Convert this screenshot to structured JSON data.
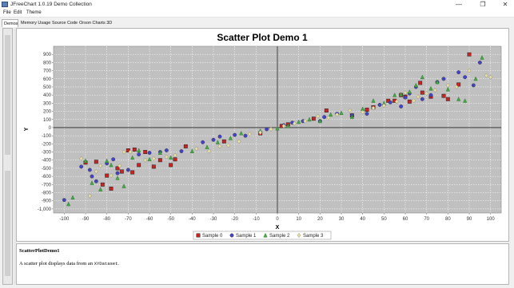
{
  "window": {
    "title": "JFreeChart 1.0.19 Demo Collection",
    "icon": "app-icon",
    "controls": [
      "—",
      "❐",
      "✕"
    ]
  },
  "menu": [
    "File",
    "Edit",
    "Theme"
  ],
  "tabs": [
    {
      "label": "Demos",
      "active": true
    },
    {
      "label": "Memory Usage",
      "active": false
    },
    {
      "label": "Source Code",
      "active": false
    },
    {
      "label": "Orson Charts 3D",
      "active": false
    }
  ],
  "description": {
    "title": "ScatterPlotDemo1",
    "text_prefix": "A scatter plot displays data from an ",
    "text_code": "XYDataset",
    "text_suffix": "."
  },
  "chart_data": {
    "type": "scatter",
    "title": "Scatter Plot Demo 1",
    "xlabel": "X",
    "ylabel": "Y",
    "xlim": [
      -105,
      105
    ],
    "ylim": [
      -1050,
      1000
    ],
    "xticks": [
      -100,
      -90,
      -80,
      -70,
      -60,
      -50,
      -40,
      -30,
      -20,
      -10,
      0,
      10,
      20,
      30,
      40,
      50,
      60,
      70,
      80,
      90,
      100
    ],
    "yticks": [
      900,
      800,
      700,
      600,
      500,
      400,
      300,
      200,
      100,
      0,
      -100,
      -200,
      -300,
      -400,
      -500,
      -600,
      -700,
      -800,
      -900,
      -1000
    ],
    "ytick_labels": [
      "900",
      "800",
      "700",
      "600",
      "500",
      "400",
      "300",
      "200",
      "100",
      "0",
      "-100",
      "-200",
      "-300",
      "-400",
      "-500",
      "-600",
      "-700",
      "-800",
      "-900",
      "-1,000"
    ],
    "grid": true,
    "legend_position": "bottom",
    "plot_background": "#c0c0c0",
    "series": [
      {
        "name": "Sample 0",
        "marker": "square",
        "color": "#cc2222",
        "points": [
          [
            -90,
            -430
          ],
          [
            -85,
            -420
          ],
          [
            -82,
            -700
          ],
          [
            -80,
            -590
          ],
          [
            -78,
            -750
          ],
          [
            -75,
            -500
          ],
          [
            -73,
            -540
          ],
          [
            -70,
            -280
          ],
          [
            -68,
            -550
          ],
          [
            -67,
            -270
          ],
          [
            -65,
            -460
          ],
          [
            -62,
            -300
          ],
          [
            -58,
            -480
          ],
          [
            -55,
            -400
          ],
          [
            -50,
            -460
          ],
          [
            -48,
            -390
          ],
          [
            -43,
            -230
          ],
          [
            -25,
            -170
          ],
          [
            -8,
            -70
          ],
          [
            2,
            20
          ],
          [
            5,
            40
          ],
          [
            17,
            110
          ],
          [
            23,
            210
          ],
          [
            35,
            150
          ],
          [
            42,
            220
          ],
          [
            45,
            250
          ],
          [
            52,
            330
          ],
          [
            55,
            330
          ],
          [
            58,
            400
          ],
          [
            60,
            380
          ],
          [
            62,
            320
          ],
          [
            67,
            550
          ],
          [
            68,
            430
          ],
          [
            72,
            380
          ],
          [
            78,
            390
          ],
          [
            80,
            350
          ],
          [
            85,
            530
          ],
          [
            90,
            900
          ]
        ]
      },
      {
        "name": "Sample 1",
        "marker": "circle",
        "color": "#4444cc",
        "points": [
          [
            -100,
            -890
          ],
          [
            -92,
            -480
          ],
          [
            -88,
            -520
          ],
          [
            -87,
            -600
          ],
          [
            -85,
            -660
          ],
          [
            -80,
            -440
          ],
          [
            -77,
            -390
          ],
          [
            -75,
            -560
          ],
          [
            -70,
            -520
          ],
          [
            -65,
            -330
          ],
          [
            -60,
            -310
          ],
          [
            -55,
            -300
          ],
          [
            -52,
            -280
          ],
          [
            -45,
            -290
          ],
          [
            -35,
            -180
          ],
          [
            -30,
            -150
          ],
          [
            -27,
            -110
          ],
          [
            -20,
            -90
          ],
          [
            -15,
            -100
          ],
          [
            -5,
            -20
          ],
          [
            3,
            30
          ],
          [
            7,
            60
          ],
          [
            12,
            80
          ],
          [
            20,
            80
          ],
          [
            22,
            130
          ],
          [
            28,
            170
          ],
          [
            35,
            150
          ],
          [
            42,
            170
          ],
          [
            48,
            280
          ],
          [
            53,
            310
          ],
          [
            58,
            260
          ],
          [
            60,
            370
          ],
          [
            62,
            420
          ],
          [
            65,
            500
          ],
          [
            68,
            350
          ],
          [
            72,
            400
          ],
          [
            75,
            560
          ],
          [
            78,
            600
          ],
          [
            85,
            680
          ],
          [
            88,
            620
          ],
          [
            92,
            520
          ],
          [
            95,
            800
          ]
        ]
      },
      {
        "name": "Sample 2",
        "marker": "triangle",
        "color": "#44aa44",
        "points": [
          [
            -98,
            -940
          ],
          [
            -96,
            -860
          ],
          [
            -90,
            -410
          ],
          [
            -87,
            -680
          ],
          [
            -83,
            -760
          ],
          [
            -80,
            -410
          ],
          [
            -78,
            -460
          ],
          [
            -75,
            -620
          ],
          [
            -72,
            -720
          ],
          [
            -68,
            -370
          ],
          [
            -65,
            -280
          ],
          [
            -60,
            -390
          ],
          [
            -55,
            -310
          ],
          [
            -50,
            -370
          ],
          [
            -40,
            -290
          ],
          [
            -33,
            -240
          ],
          [
            -28,
            -180
          ],
          [
            -22,
            -130
          ],
          [
            -17,
            -70
          ],
          [
            -8,
            -40
          ],
          [
            0,
            -10
          ],
          [
            5,
            20
          ],
          [
            10,
            70
          ],
          [
            15,
            100
          ],
          [
            20,
            80
          ],
          [
            25,
            160
          ],
          [
            30,
            180
          ],
          [
            35,
            130
          ],
          [
            40,
            230
          ],
          [
            45,
            330
          ],
          [
            50,
            300
          ],
          [
            55,
            400
          ],
          [
            58,
            410
          ],
          [
            62,
            440
          ],
          [
            65,
            520
          ],
          [
            68,
            620
          ],
          [
            72,
            480
          ],
          [
            75,
            560
          ],
          [
            80,
            470
          ],
          [
            85,
            350
          ],
          [
            88,
            330
          ],
          [
            93,
            600
          ],
          [
            96,
            860
          ]
        ]
      },
      {
        "name": "Sample 3",
        "marker": "diamond",
        "color": "#e8e0a0",
        "points": [
          [
            -92,
            -380
          ],
          [
            -88,
            -840
          ],
          [
            -85,
            -540
          ],
          [
            -83,
            -470
          ],
          [
            -78,
            -590
          ],
          [
            -74,
            -470
          ],
          [
            -72,
            -300
          ],
          [
            -69,
            -300
          ],
          [
            -62,
            -400
          ],
          [
            -58,
            -380
          ],
          [
            -52,
            -360
          ],
          [
            -48,
            -340
          ],
          [
            -38,
            -260
          ],
          [
            -32,
            -290
          ],
          [
            -27,
            -230
          ],
          [
            -23,
            -220
          ],
          [
            -18,
            -170
          ],
          [
            -13,
            -80
          ],
          [
            -8,
            -60
          ],
          [
            -3,
            -20
          ],
          [
            3,
            20
          ],
          [
            8,
            50
          ],
          [
            13,
            80
          ],
          [
            19,
            140
          ],
          [
            24,
            120
          ],
          [
            28,
            160
          ],
          [
            34,
            210
          ],
          [
            40,
            190
          ],
          [
            45,
            240
          ],
          [
            50,
            270
          ],
          [
            56,
            320
          ],
          [
            60,
            430
          ],
          [
            64,
            330
          ],
          [
            66,
            380
          ],
          [
            70,
            420
          ],
          [
            74,
            460
          ],
          [
            80,
            520
          ],
          [
            84,
            500
          ],
          [
            90,
            700
          ],
          [
            98,
            640
          ],
          [
            100,
            620
          ]
        ]
      }
    ]
  }
}
